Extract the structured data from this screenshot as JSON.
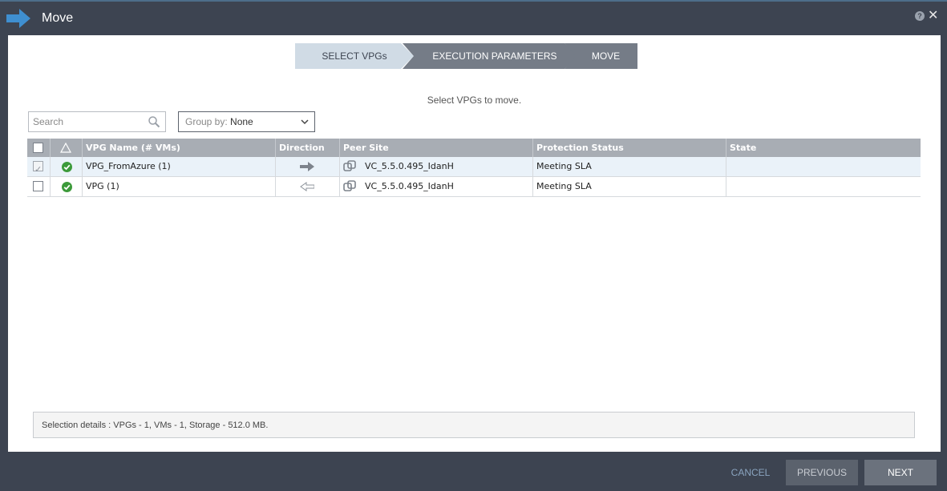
{
  "dialog": {
    "title": "Move",
    "icons": {
      "title": "move-arrow-icon",
      "help": "help-icon",
      "close": "close-icon"
    },
    "help_glyph": "?",
    "close_glyph": "✕"
  },
  "wizard": {
    "steps": [
      {
        "label": "SELECT VPGs",
        "active": true
      },
      {
        "label": "EXECUTION PARAMETERS",
        "active": false
      },
      {
        "label": "MOVE",
        "active": false
      }
    ]
  },
  "instruction": "Select VPGs to move.",
  "search": {
    "placeholder": "Search",
    "value": ""
  },
  "group_by": {
    "label": "Group by:",
    "value": "None"
  },
  "table": {
    "columns": [
      "VPG Name (# VMs)",
      "Direction",
      "Peer Site",
      "Protection Status",
      "State"
    ],
    "status_header_icon": "alert-triangle-icon",
    "rows": [
      {
        "checked": true,
        "status_icon": "check-circle-icon",
        "name": "VPG_FromAzure (1)",
        "direction_icon": "arrow-right-solid-icon",
        "peer_site": "VC_5.5.0.495_IdanH",
        "peer_icon": "vcenter-icon",
        "protection_status": "Meeting SLA",
        "state": ""
      },
      {
        "checked": false,
        "status_icon": "check-circle-icon",
        "name": "VPG (1)",
        "direction_icon": "arrow-left-outline-icon",
        "peer_site": "VC_5.5.0.495_IdanH",
        "peer_icon": "vcenter-icon",
        "protection_status": "Meeting SLA",
        "state": ""
      }
    ]
  },
  "selection_details": "Selection details :  VPGs  -  1, VMs  -  1, Storage  -  512.0 MB.",
  "buttons": {
    "cancel": "CANCEL",
    "previous": "PREVIOUS",
    "next": "NEXT"
  },
  "colors": {
    "frame": "#3d4451",
    "active_step": "#d0dbe5",
    "inactive_step": "#757c87",
    "status_ok": "#3c9a3a",
    "header": "#a8adb4",
    "link": "#8aa4bf"
  }
}
